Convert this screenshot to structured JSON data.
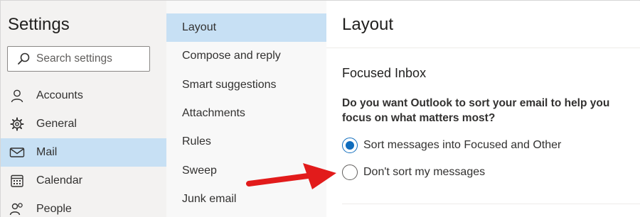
{
  "settings": {
    "title": "Settings",
    "search_placeholder": "Search settings"
  },
  "nav": {
    "items": [
      {
        "label": "Accounts",
        "icon": "person-icon"
      },
      {
        "label": "General",
        "icon": "gear-icon"
      },
      {
        "label": "Mail",
        "icon": "mail-icon",
        "selected": true
      },
      {
        "label": "Calendar",
        "icon": "calendar-icon"
      },
      {
        "label": "People",
        "icon": "people-icon"
      }
    ]
  },
  "submenu": {
    "items": [
      {
        "label": "Layout",
        "selected": true
      },
      {
        "label": "Compose and reply"
      },
      {
        "label": "Smart suggestions"
      },
      {
        "label": "Attachments"
      },
      {
        "label": "Rules"
      },
      {
        "label": "Sweep"
      },
      {
        "label": "Junk email"
      }
    ]
  },
  "content": {
    "title": "Layout",
    "section_title": "Focused Inbox",
    "question": "Do you want Outlook to sort your email to help you focus on what matters most?",
    "options": [
      {
        "label": "Sort messages into Focused and Other",
        "checked": true
      },
      {
        "label": "Don't sort my messages",
        "checked": false
      }
    ]
  },
  "colors": {
    "selected_bg": "#c7e0f4",
    "radio_accent": "#0f6cbd",
    "annotation_arrow": "#e21b1b"
  }
}
